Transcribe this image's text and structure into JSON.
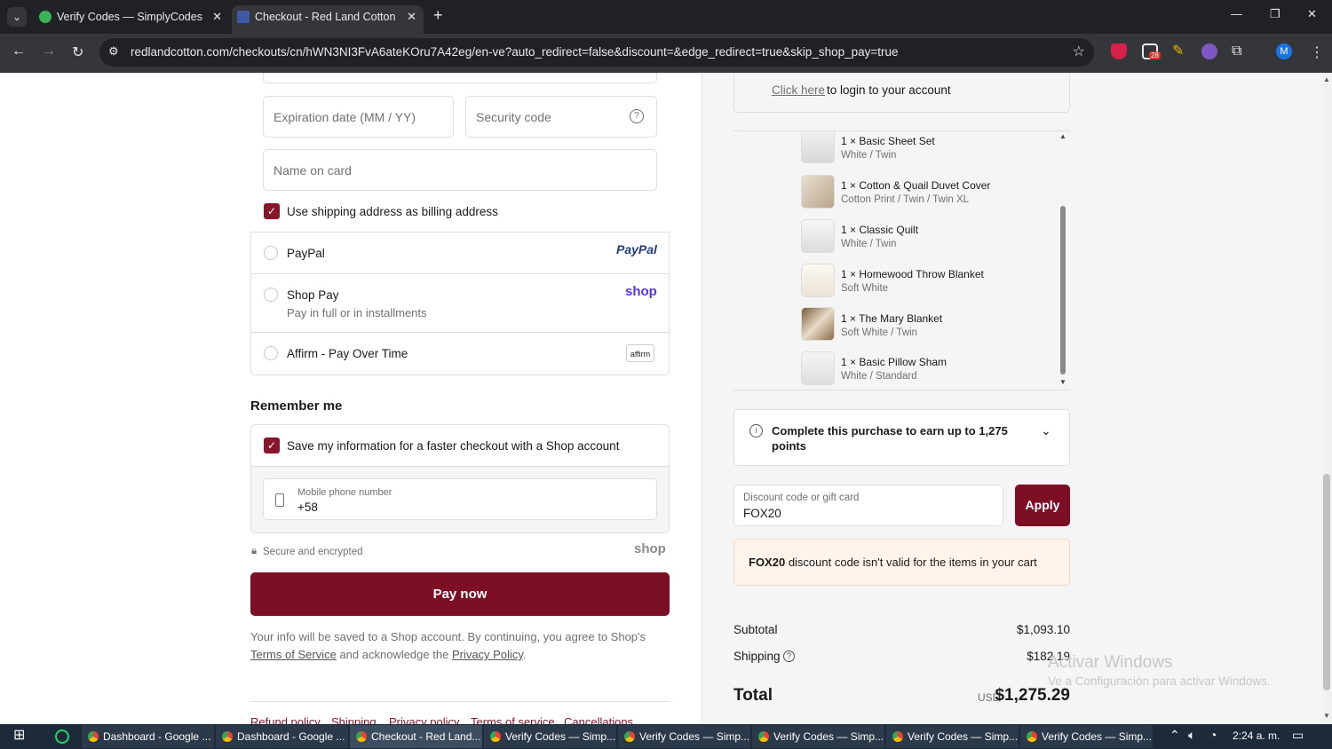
{
  "browser": {
    "tabs": [
      {
        "title": "Verify Codes — SimplyCodes",
        "active": false,
        "favicon_color": "#3ab45a"
      },
      {
        "title": "Checkout - Red Land Cotton",
        "active": true,
        "favicon_color": "#3c5aa6"
      }
    ],
    "url": "redlandcotton.com/checkouts/cn/hWN3NI3FvA6ateKOru7A42eg/en-ve?auto_redirect=false&discount=&edge_redirect=true&skip_shop_pay=true",
    "ext_badge": "28",
    "profile_initial": "M"
  },
  "payment": {
    "expiration_placeholder": "Expiration date (MM / YY)",
    "security_placeholder": "Security code",
    "name_placeholder": "Name on card",
    "use_shipping_label": "Use shipping address as billing address",
    "methods": [
      {
        "name": "PayPal",
        "logo": "PayPal"
      },
      {
        "name": "Shop Pay",
        "subtitle": "Pay in full or in installments",
        "logo": "shop"
      },
      {
        "name": "Affirm - Pay Over Time",
        "logo": "affirm"
      }
    ]
  },
  "remember": {
    "heading": "Remember me",
    "save_label": "Save my information for a faster checkout with a Shop account",
    "phone_label": "Mobile phone number",
    "phone_value": "+58",
    "secure_text": "Secure and encrypted",
    "shop_brand": "shop"
  },
  "pay_button": "Pay now",
  "disclaimer": {
    "line1": "Your info will be saved to a Shop account. By continuing, you agree to Shop's",
    "terms_link": "Terms of Service",
    "middle": "and acknowledge the",
    "privacy_link": "Privacy Policy",
    "end": "."
  },
  "footer_links": [
    "Refund policy",
    "Shipping",
    "Privacy policy",
    "Terms of service",
    "Cancellations"
  ],
  "summary": {
    "login_link": "Click here",
    "login_text": "to login to your account",
    "items": [
      {
        "name": "1 × Basic Sheet Set",
        "variant": "White / Twin"
      },
      {
        "name": "1 × Cotton & Quail Duvet Cover",
        "variant": "Cotton Print / Twin / Twin XL"
      },
      {
        "name": "1 × Classic Quilt",
        "variant": "White / Twin"
      },
      {
        "name": "1 × Homewood Throw Blanket",
        "variant": "Soft White"
      },
      {
        "name": "1 × The Mary Blanket",
        "variant": "Soft White / Twin"
      },
      {
        "name": "1 × Basic Pillow Sham",
        "variant": "White / Standard"
      }
    ],
    "points_text": "Complete this purchase to earn up to 1,275",
    "points_text2": "points",
    "discount_label": "Discount code or gift card",
    "discount_value": "FOX20",
    "apply_label": "Apply",
    "warning_code": "FOX20",
    "warning_text": "discount code isn't valid for the items in your cart",
    "subtotal_label": "Subtotal",
    "subtotal_value": "$1,093.10",
    "shipping_label": "Shipping",
    "shipping_value": "$182.19",
    "total_label": "Total",
    "currency": "USD",
    "total_value": "$1,275.29"
  },
  "watermark": {
    "line1": "Activar Windows",
    "line2": "Ve a Configuración para activar Windows."
  },
  "taskbar": {
    "apps": [
      "Dashboard - Google ...",
      "Dashboard - Google ...",
      "Checkout - Red Land...",
      "Verify Codes — Simp...",
      "Verify Codes — Simp...",
      "Verify Codes — Simp...",
      "Verify Codes — Simp...",
      "Verify Codes — Simp..."
    ],
    "clock": "2:24 a. m."
  }
}
